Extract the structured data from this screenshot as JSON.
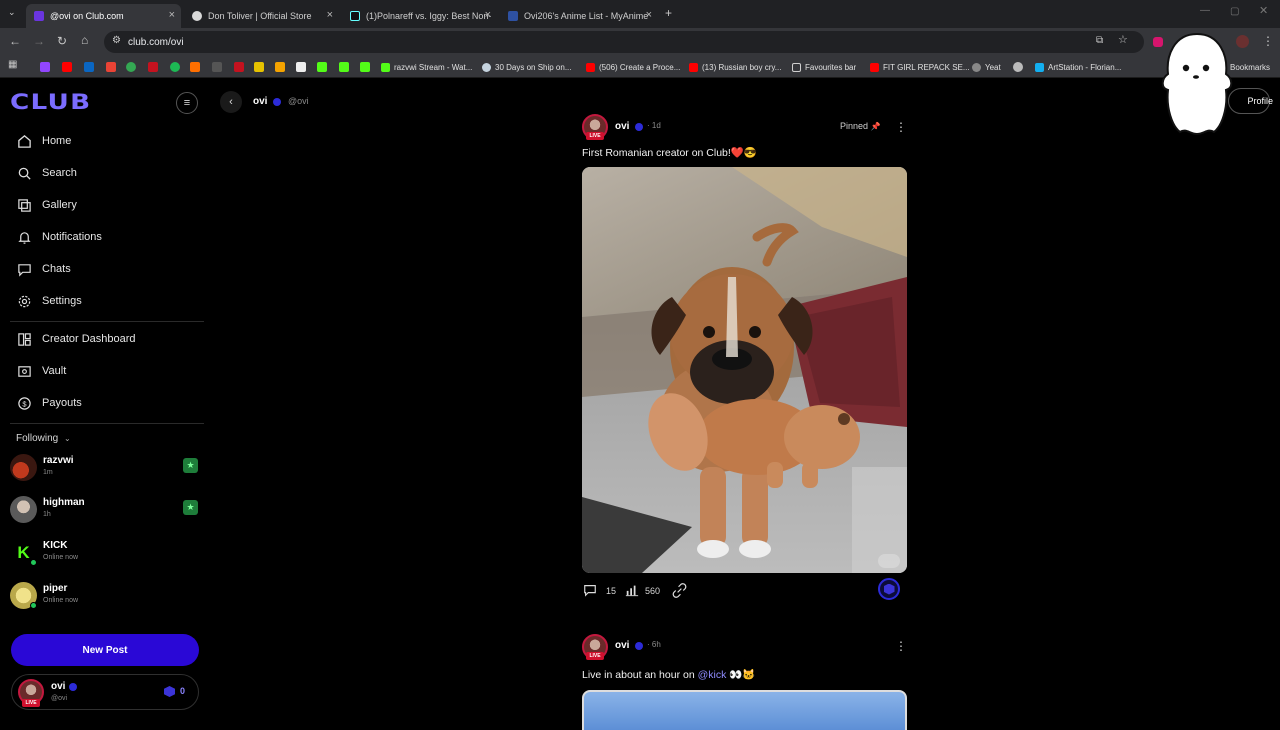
{
  "browser": {
    "tabs": [
      {
        "label": "@ovi on Club.com",
        "color": "#6a35e0"
      },
      {
        "label": "Don Toliver | Official Store",
        "color": "#d9d9d9"
      },
      {
        "label": "(1)Polnareff vs. Iggy: Best Non-",
        "color": "#111111"
      },
      {
        "label": "Ovi206's Anime List - MyAnime",
        "color": "#2e51a2"
      }
    ],
    "url": "club.com/ovi",
    "bookmarks": [
      {
        "label": "razvwi Stream - Wat...",
        "color": "#53fc18"
      },
      {
        "label": "30 Days on Ship on...",
        "color": "#c6d4df"
      },
      {
        "label": "(506) Create a Proce...",
        "color": "#ff0000"
      },
      {
        "label": "(13) Russian boy cry...",
        "color": "#ff0000"
      },
      {
        "label": "Favourites bar",
        "color": "#cfcfcf"
      },
      {
        "label": "FIT GIRL REPACK SE...",
        "color": "#ff0000"
      },
      {
        "label": "Yeat",
        "color": "#888888"
      },
      {
        "label": "ArtStation - Florian...",
        "color": "#13aff0"
      },
      {
        "label": "Bookmarks",
        "color": "#cfcfcf"
      }
    ]
  },
  "brand": {
    "logo": "CLUB",
    "accent": "#7b6cff"
  },
  "sidebar": {
    "nav": [
      {
        "label": "Home",
        "icon": "home-icon"
      },
      {
        "label": "Search",
        "icon": "search-icon"
      },
      {
        "label": "Gallery",
        "icon": "gallery-icon"
      },
      {
        "label": "Notifications",
        "icon": "bell-icon"
      },
      {
        "label": "Chats",
        "icon": "chat-icon"
      },
      {
        "label": "Settings",
        "icon": "gear-icon"
      }
    ],
    "creator": [
      {
        "label": "Creator Dashboard",
        "icon": "dashboard-icon"
      },
      {
        "label": "Vault",
        "icon": "vault-icon"
      },
      {
        "label": "Payouts",
        "icon": "dollar-icon"
      }
    ],
    "following_label": "Following",
    "following": [
      {
        "name": "razvwi",
        "sub": "1m",
        "starred": true
      },
      {
        "name": "highman",
        "sub": "1h",
        "starred": true
      },
      {
        "name": "KICK",
        "sub": "Online now",
        "starred": false
      },
      {
        "name": "piper",
        "sub": "Online now",
        "starred": false
      }
    ],
    "new_post": "New Post",
    "me": {
      "name": "ovi",
      "handle": "@ovi",
      "badge": "LIVE",
      "count": "0"
    }
  },
  "profile_header": {
    "name": "ovi",
    "handle": "@ovi",
    "profile_button": "Profile"
  },
  "posts": [
    {
      "author": "ovi",
      "time": "1d",
      "live": "LIVE",
      "pinned": "Pinned",
      "text": "First Romanian creator on Club!❤️😎",
      "comments": "15",
      "views": "560"
    },
    {
      "author": "ovi",
      "time": "6h",
      "live": "LIVE",
      "text_prefix": "Live in about an hour on",
      "mention": "@kick",
      "text_suffix": "👀🐱"
    }
  ]
}
